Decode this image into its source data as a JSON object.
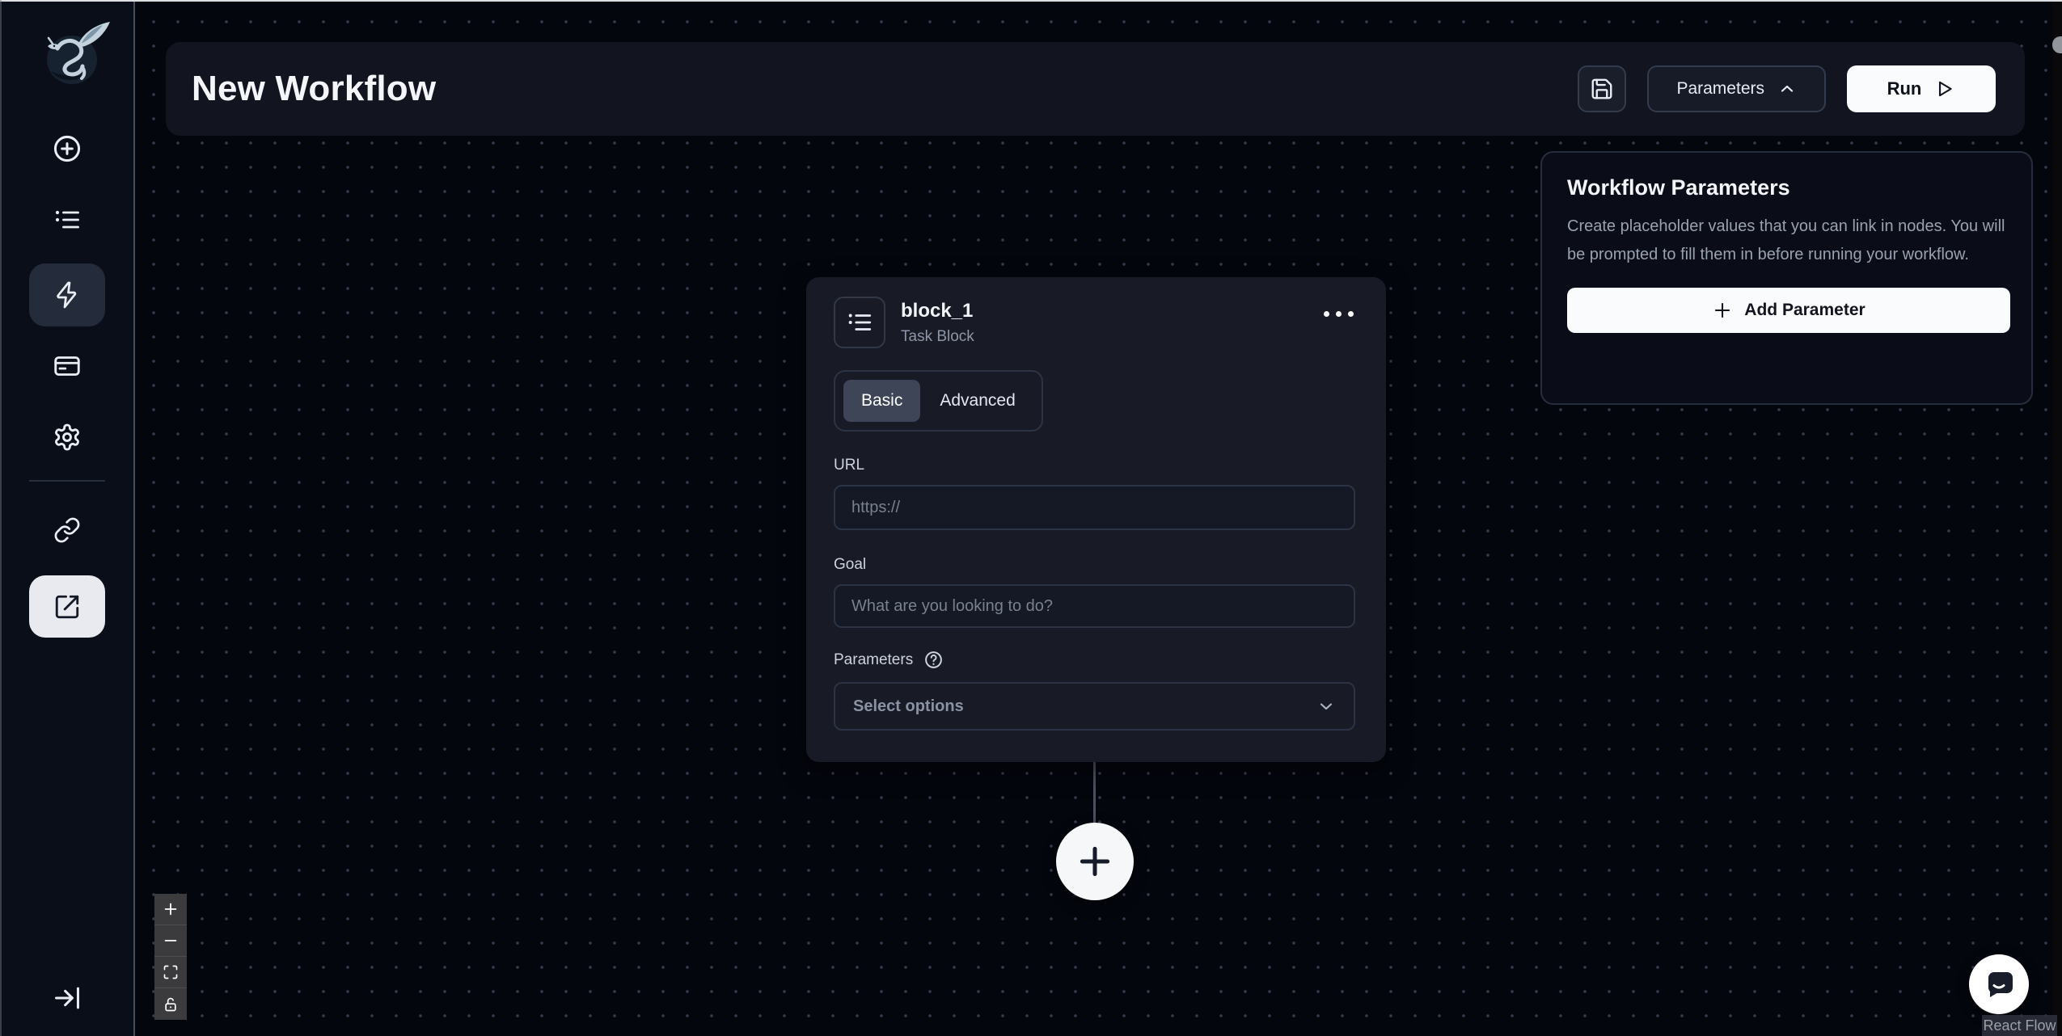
{
  "colors": {
    "canvas_bg": "#04060e",
    "sidebar_bg": "#0a0e19",
    "surface_bg": "#12151f",
    "card_bg": "#181b26",
    "border": "#2c3344",
    "selected_tab_bg": "#3d4556",
    "accent_white": "#fafbfd",
    "text_muted": "#8d95a6"
  },
  "sidebar": {
    "logo": "skyvern-dragon-logo",
    "items": [
      {
        "icon": "plus-circle-icon",
        "selected": false
      },
      {
        "icon": "list-icon",
        "selected": false
      },
      {
        "icon": "zap-icon",
        "selected": true
      },
      {
        "icon": "credit-card-icon",
        "selected": false
      },
      {
        "icon": "settings-gear-icon",
        "selected": false
      },
      {
        "icon": "link-icon",
        "selected": false
      },
      {
        "icon": "external-link-icon",
        "selected": true
      }
    ],
    "collapse_icon": "arrow-right-to-line-icon"
  },
  "header": {
    "title": "New Workflow",
    "save_icon": "save-icon",
    "parameters_button": {
      "label": "Parameters",
      "icon": "chevron-up-icon"
    },
    "run_button": {
      "label": "Run",
      "icon": "play-icon"
    }
  },
  "node": {
    "icon": "list-icon",
    "title": "block_1",
    "subtitle": "Task Block",
    "menu_icon": "ellipsis-icon",
    "tabs": [
      {
        "label": "Basic",
        "selected": true
      },
      {
        "label": "Advanced",
        "selected": false
      }
    ],
    "url_field": {
      "label": "URL",
      "placeholder": "https://",
      "value": ""
    },
    "goal_field": {
      "label": "Goal",
      "placeholder": "What are you looking to do?",
      "value": ""
    },
    "parameters_field": {
      "label": "Parameters",
      "help_icon": "help-circle-icon",
      "value": "Select options",
      "icon": "chevron-down-icon"
    }
  },
  "canvas": {
    "add_block_icon": "plus-icon",
    "edge": "connector-line"
  },
  "workflow_parameters_panel": {
    "title": "Workflow Parameters",
    "description": "Create placeholder values that you can link in nodes. You will be prompted to fill them in before running your workflow.",
    "add_button_label": "Add Parameter",
    "add_button_icon": "plus-icon"
  },
  "controls": {
    "zoom_in": "plus-icon",
    "zoom_out": "minus-icon",
    "fit_view": "fit-view-icon",
    "lock": "unlock-icon"
  },
  "chat": {
    "icon": "chat-bubble-icon"
  },
  "attribution": {
    "label": "React Flow"
  }
}
